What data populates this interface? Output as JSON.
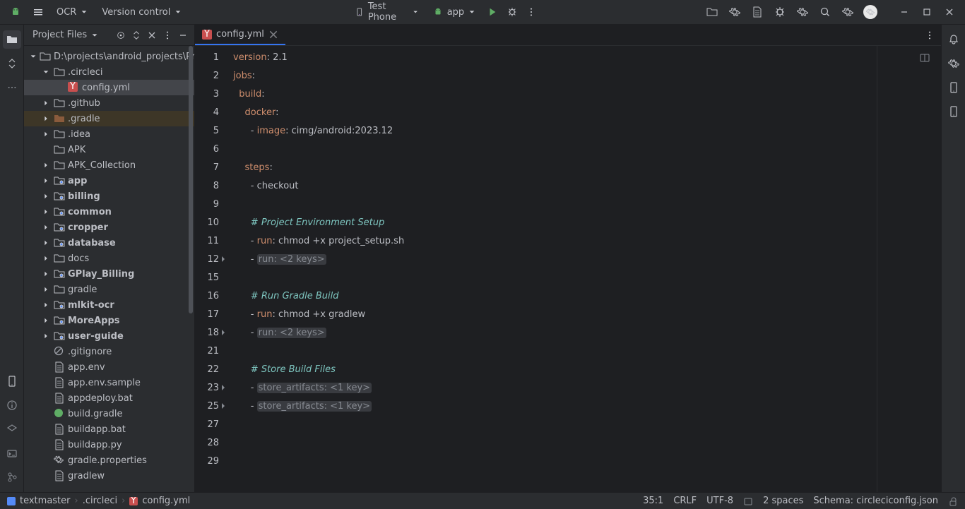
{
  "titlebar": {
    "project": "OCR",
    "vcs": "Version control",
    "device": "Test Phone",
    "runconfig": "app"
  },
  "sidebar": {
    "title": "Project Files",
    "root": "D:\\projects\\android_projects\\Pro",
    "items": [
      {
        "depth": 1,
        "exp": true,
        "icon": "folder",
        "label": ".circleci"
      },
      {
        "depth": 2,
        "exp": null,
        "icon": "yaml",
        "label": "config.yml",
        "selected": true
      },
      {
        "depth": 1,
        "exp": false,
        "icon": "folder",
        "label": ".github"
      },
      {
        "depth": 1,
        "exp": false,
        "icon": "folder-ex",
        "label": ".gradle",
        "hl": true
      },
      {
        "depth": 1,
        "exp": false,
        "icon": "folder-dim",
        "label": ".idea"
      },
      {
        "depth": 1,
        "exp": null,
        "icon": "folder",
        "label": "APK"
      },
      {
        "depth": 1,
        "exp": false,
        "icon": "folder",
        "label": "APK_Collection"
      },
      {
        "depth": 1,
        "exp": false,
        "icon": "module",
        "label": "app",
        "bold": true
      },
      {
        "depth": 1,
        "exp": false,
        "icon": "module",
        "label": "billing",
        "bold": true
      },
      {
        "depth": 1,
        "exp": false,
        "icon": "module",
        "label": "common",
        "bold": true
      },
      {
        "depth": 1,
        "exp": false,
        "icon": "module",
        "label": "cropper",
        "bold": true
      },
      {
        "depth": 1,
        "exp": false,
        "icon": "module",
        "label": "database",
        "bold": true
      },
      {
        "depth": 1,
        "exp": false,
        "icon": "folder",
        "label": "docs"
      },
      {
        "depth": 1,
        "exp": false,
        "icon": "module",
        "label": "GPlay_Billing",
        "bold": true
      },
      {
        "depth": 1,
        "exp": false,
        "icon": "folder",
        "label": "gradle"
      },
      {
        "depth": 1,
        "exp": false,
        "icon": "module",
        "label": "mlkit-ocr",
        "bold": true
      },
      {
        "depth": 1,
        "exp": false,
        "icon": "module",
        "label": "MoreApps",
        "bold": true
      },
      {
        "depth": 1,
        "exp": false,
        "icon": "module",
        "label": "user-guide",
        "bold": true
      },
      {
        "depth": 1,
        "exp": null,
        "icon": "ignore",
        "label": ".gitignore"
      },
      {
        "depth": 1,
        "exp": null,
        "icon": "file",
        "label": "app.env"
      },
      {
        "depth": 1,
        "exp": null,
        "icon": "file",
        "label": "app.env.sample"
      },
      {
        "depth": 1,
        "exp": null,
        "icon": "file",
        "label": "appdeploy.bat"
      },
      {
        "depth": 1,
        "exp": null,
        "icon": "gradle",
        "label": "build.gradle"
      },
      {
        "depth": 1,
        "exp": null,
        "icon": "file",
        "label": "buildapp.bat"
      },
      {
        "depth": 1,
        "exp": null,
        "icon": "file",
        "label": "buildapp.py"
      },
      {
        "depth": 1,
        "exp": null,
        "icon": "gear",
        "label": "gradle.properties"
      },
      {
        "depth": 1,
        "exp": null,
        "icon": "file",
        "label": "gradlew"
      }
    ]
  },
  "tab": {
    "name": "config.yml"
  },
  "code": {
    "lines": [
      {
        "n": 1,
        "seg": [
          [
            "k",
            "version"
          ],
          [
            "p",
            ": "
          ],
          [
            "d",
            "2.1"
          ]
        ]
      },
      {
        "n": 2,
        "seg": [
          [
            "k",
            "jobs"
          ],
          [
            "p",
            ":"
          ]
        ]
      },
      {
        "n": 3,
        "ind": 1,
        "seg": [
          [
            "k",
            "build"
          ],
          [
            "p",
            ":"
          ]
        ]
      },
      {
        "n": 4,
        "ind": 2,
        "seg": [
          [
            "k",
            "docker"
          ],
          [
            "p",
            ":"
          ]
        ]
      },
      {
        "n": 5,
        "ind": 3,
        "seg": [
          [
            "p",
            "- "
          ],
          [
            "k",
            "image"
          ],
          [
            "p",
            ": "
          ],
          [
            "d",
            "cimg/android:2023.12"
          ]
        ]
      },
      {
        "n": 6,
        "seg": []
      },
      {
        "n": 7,
        "ind": 2,
        "seg": [
          [
            "k",
            "steps"
          ],
          [
            "p",
            ":"
          ]
        ]
      },
      {
        "n": 8,
        "ind": 3,
        "seg": [
          [
            "p",
            "- checkout"
          ]
        ]
      },
      {
        "n": 9,
        "seg": []
      },
      {
        "n": 10,
        "ind": 3,
        "seg": [
          [
            "c",
            "# Project Environment Setup"
          ]
        ]
      },
      {
        "n": 11,
        "ind": 3,
        "seg": [
          [
            "p",
            "- "
          ],
          [
            "k",
            "run"
          ],
          [
            "p",
            ": "
          ],
          [
            "d",
            "chmod +x project_setup.sh"
          ]
        ]
      },
      {
        "n": 12,
        "ind": 3,
        "fold": true,
        "seg": [
          [
            "p",
            "- "
          ],
          [
            "f",
            "run: <2 keys>"
          ]
        ]
      },
      {
        "n": 15,
        "seg": []
      },
      {
        "n": 16,
        "ind": 3,
        "seg": [
          [
            "c",
            "# Run Gradle Build"
          ]
        ]
      },
      {
        "n": 17,
        "ind": 3,
        "seg": [
          [
            "p",
            "- "
          ],
          [
            "k",
            "run"
          ],
          [
            "p",
            ": "
          ],
          [
            "d",
            "chmod +x gradlew"
          ]
        ]
      },
      {
        "n": 18,
        "ind": 3,
        "fold": true,
        "seg": [
          [
            "p",
            "- "
          ],
          [
            "f",
            "run: <2 keys>"
          ]
        ]
      },
      {
        "n": 21,
        "seg": []
      },
      {
        "n": 22,
        "ind": 3,
        "seg": [
          [
            "c",
            "# Store Build Files"
          ]
        ]
      },
      {
        "n": 23,
        "ind": 3,
        "fold": true,
        "seg": [
          [
            "p",
            "- "
          ],
          [
            "f",
            "store_artifacts: <1 key>"
          ]
        ]
      },
      {
        "n": 25,
        "ind": 3,
        "fold": true,
        "seg": [
          [
            "p",
            "- "
          ],
          [
            "f",
            "store_artifacts: <1 key>"
          ]
        ]
      },
      {
        "n": 27,
        "seg": []
      },
      {
        "n": 28,
        "seg": []
      },
      {
        "n": 29,
        "seg": []
      }
    ]
  },
  "breadcrumbs": [
    "textmaster",
    ".circleci",
    "config.yml"
  ],
  "status": {
    "pos": "35:1",
    "eol": "CRLF",
    "enc": "UTF-8",
    "indent": "2 spaces",
    "schema": "Schema: circleciconfig.json"
  }
}
